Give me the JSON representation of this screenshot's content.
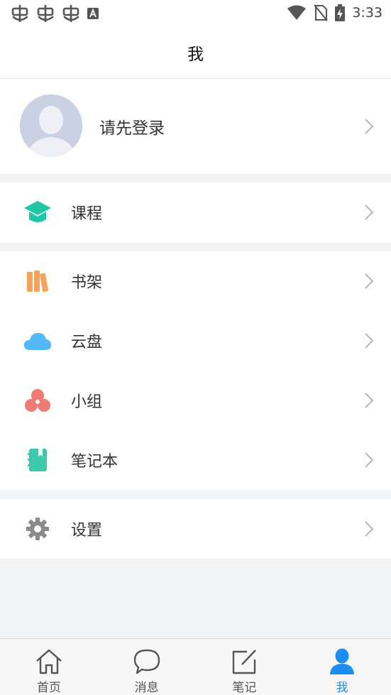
{
  "status_bar": {
    "time": "3:33",
    "notification_icons": [
      "bug-icon",
      "bug-icon",
      "bug-icon",
      "a-box-icon"
    ]
  },
  "header": {
    "title": "我"
  },
  "profile": {
    "login_prompt": "请先登录"
  },
  "menu": {
    "course": {
      "label": "课程",
      "icon": "graduation-cap-icon",
      "color": "#1ec8a6"
    },
    "bookshelf": {
      "label": "书架",
      "icon": "books-icon",
      "color": "#f5a35b"
    },
    "cloud": {
      "label": "云盘",
      "icon": "cloud-icon",
      "color": "#52b8f7"
    },
    "group": {
      "label": "小组",
      "icon": "group-icon",
      "color": "#f07a74"
    },
    "notebook": {
      "label": "笔记本",
      "icon": "notebook-icon",
      "color": "#3ec9ad"
    },
    "settings": {
      "label": "设置",
      "icon": "gear-icon",
      "color": "#8a8a8a"
    }
  },
  "tabs": [
    {
      "label": "首页",
      "icon": "home-icon",
      "active": false
    },
    {
      "label": "消息",
      "icon": "chat-bubble-icon",
      "active": false
    },
    {
      "label": "笔记",
      "icon": "edit-note-icon",
      "active": false
    },
    {
      "label": "我",
      "icon": "person-icon",
      "active": true
    }
  ],
  "colors": {
    "accent": "#1a8ff1",
    "background": "#f2f3f5"
  }
}
